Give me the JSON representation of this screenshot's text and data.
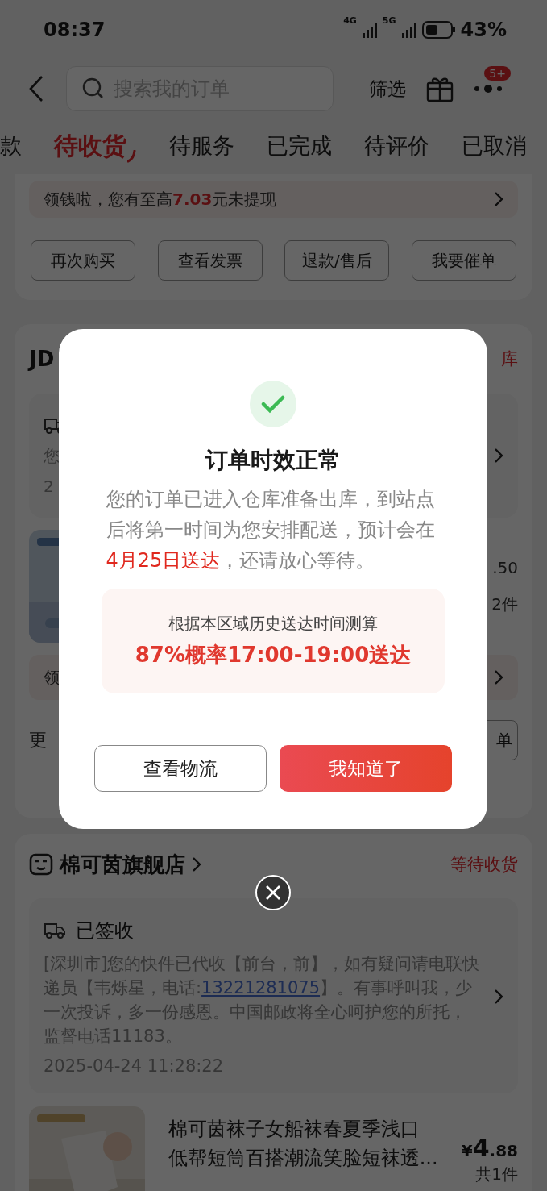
{
  "status_bar": {
    "time": "08:37",
    "network_1": "4G",
    "network_2": "5G",
    "battery": "43%"
  },
  "header": {
    "search": {
      "placeholder": "搜索我的订单"
    },
    "filter": "筛选",
    "badge": "5+"
  },
  "tabs": [
    {
      "label": "款",
      "selected": false
    },
    {
      "label": "待收货",
      "selected": true
    },
    {
      "label": "待服务",
      "selected": false
    },
    {
      "label": "已完成",
      "selected": false
    },
    {
      "label": "待评价",
      "selected": false
    },
    {
      "label": "已取消",
      "selected": false
    }
  ],
  "order_1": {
    "promo": "领钱啦，您有至高**7.03**元未提现",
    "buttons": [
      "再次购买",
      "查看发票",
      "退款/售后",
      "我要催单"
    ]
  },
  "order_2": {
    "store": "JD",
    "status": "库",
    "logistics_text": "您",
    "logistics_time": "2",
    "price": ".50",
    "count": "2件",
    "promo": "领",
    "more": "更",
    "button": "单"
  },
  "order_3": {
    "store": "棉可茵旗舰店",
    "status": "等待收货",
    "logistics": {
      "title": "已签收",
      "text_before": "[深圳市]您的快件已代收【前台，前】，如有疑问请电联快递员【韦烁星，电话:",
      "phone": "13221281075",
      "text_after": "】。有事呼叫我，少一次投诉，多一份感恩。中国邮政将全心呵护您的所托，监督电话11183。",
      "time": "2025-04-24 11:28:22"
    },
    "product": {
      "title": "棉可茵袜子女船袜春夏季浅口低帮短筒百搭潮流笑脸短袜透...",
      "currency": "¥",
      "price_int": "4",
      "price_dec": ".88",
      "count": "共1件"
    }
  },
  "dialog": {
    "title": "订单时效正常",
    "message_before": "您的订单已进入仓库准备出库，到站点后将第一时间为您安排配送，预计会在",
    "message_highlight": "4月25日送达",
    "message_after": "，还请放心等待。",
    "estimate": {
      "basis": "根据本区域历史送达时间测算",
      "result": "87%概率17:00-19:00送达"
    },
    "buttons": [
      {
        "label": "查看物流",
        "kind": "secondary"
      },
      {
        "label": "我知道了",
        "kind": "primary"
      }
    ]
  }
}
